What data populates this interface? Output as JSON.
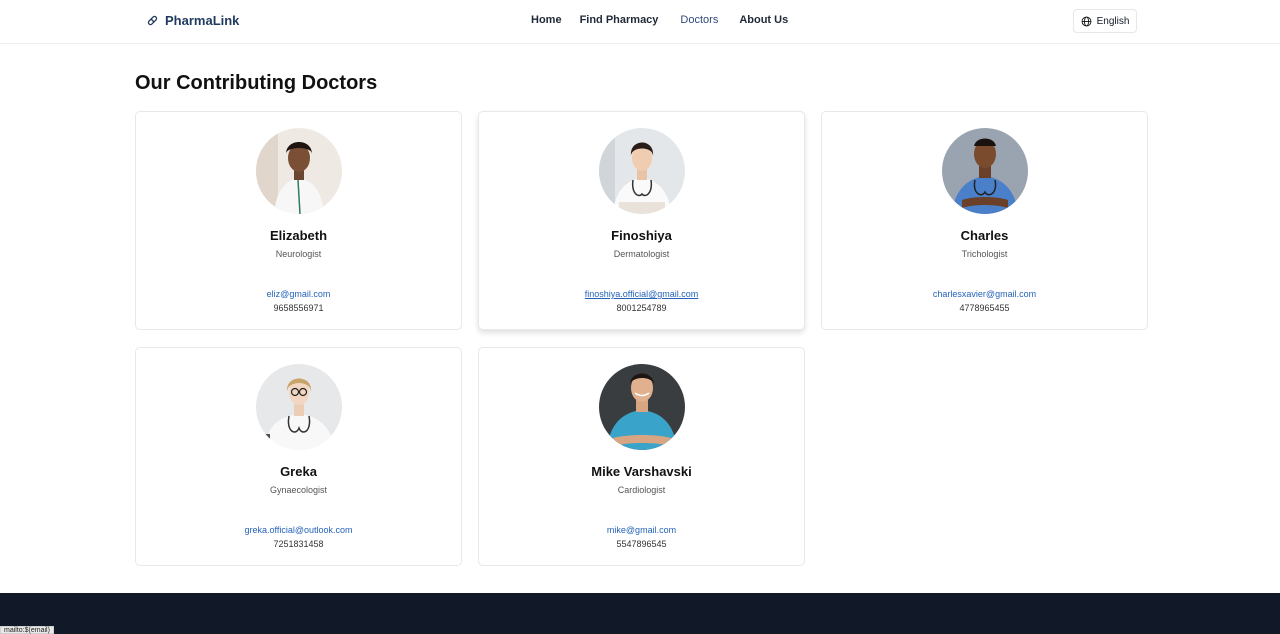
{
  "brand": {
    "name": "PharmaLink"
  },
  "nav": {
    "links": [
      "Home",
      "Find Pharmacy",
      "Doctors",
      "About Us"
    ],
    "active": "Doctors",
    "language": "English"
  },
  "page": {
    "title": "Our Contributing Doctors"
  },
  "doctors": [
    {
      "name": "Elizabeth",
      "specialty": "Neurologist",
      "email": "eliz@gmail.com",
      "phone": "9658556971"
    },
    {
      "name": "Finoshiya",
      "specialty": "Dermatologist",
      "email": "finoshiya.official@gmail.com",
      "phone": "8001254789"
    },
    {
      "name": "Charles",
      "specialty": "Trichologist",
      "email": "charlesxavier@gmail.com",
      "phone": "4778965455"
    },
    {
      "name": "Greka",
      "specialty": "Gynaecologist",
      "email": "greka.official@outlook.com",
      "phone": "7251831458"
    },
    {
      "name": "Mike Varshavski",
      "specialty": "Cardiologist",
      "email": "mike@gmail.com",
      "phone": "5547896545"
    }
  ],
  "status_bar": {
    "url": "mailto:$(email)"
  },
  "colors": {
    "brand": "#1f3a5f",
    "link": "#2563b8",
    "footer": "#111827"
  }
}
